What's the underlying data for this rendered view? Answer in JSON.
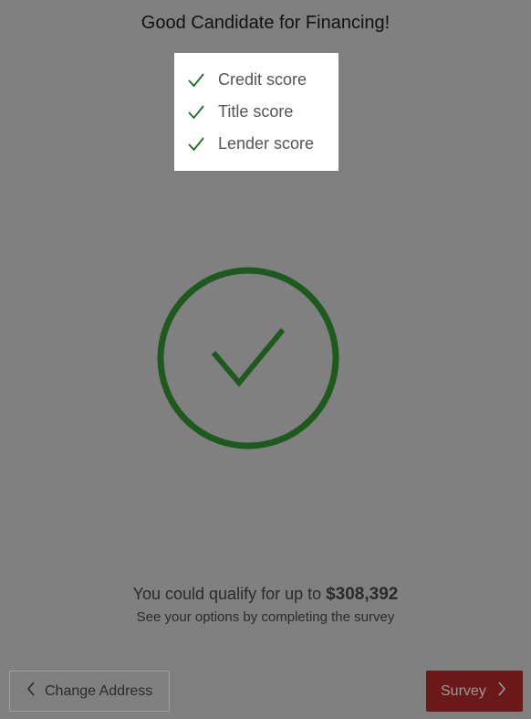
{
  "title": "Good Candidate for Financing!",
  "checklist": [
    {
      "label": "Credit score",
      "icon": "checkmark-icon"
    },
    {
      "label": "Title score",
      "icon": "checkmark-icon"
    },
    {
      "label": "Lender score",
      "icon": "checkmark-icon"
    }
  ],
  "result": {
    "icon": "circle-check-icon",
    "qualify_prefix": "You could qualify for up to ",
    "qualify_amount": "$308,392",
    "subtext": "See your options by completing the survey"
  },
  "nav": {
    "back_label": "Change Address",
    "back_icon": "chevron-left-icon",
    "next_label": "Survey",
    "next_icon": "chevron-right-icon"
  },
  "colors": {
    "background": "#808080",
    "check_green": "#1e5a1e",
    "next_button": "#6a1818"
  }
}
